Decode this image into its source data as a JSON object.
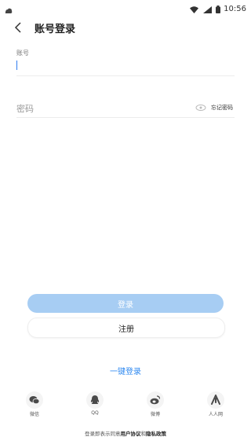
{
  "status_bar": {
    "time": "10:56"
  },
  "header": {
    "title": "账号登录"
  },
  "account": {
    "label": "账号",
    "value": ""
  },
  "password": {
    "placeholder": "密码",
    "forgot_label": "忘记密码"
  },
  "buttons": {
    "login": "登录",
    "register": "注册"
  },
  "one_key_login": "一键登录",
  "social": [
    {
      "label": "微信",
      "icon": "wechat-icon"
    },
    {
      "label": "QQ",
      "icon": "qq-icon"
    },
    {
      "label": "微博",
      "icon": "weibo-icon"
    },
    {
      "label": "人人网",
      "icon": "renren-icon"
    }
  ],
  "agreement": {
    "prefix": "登录即表示同意",
    "user_agreement": "用户协议",
    "and": "和",
    "privacy": "隐私政策"
  },
  "colors": {
    "accent": "#2f89f0",
    "login_button": "#a7cdf3",
    "divider": "#ececec"
  }
}
